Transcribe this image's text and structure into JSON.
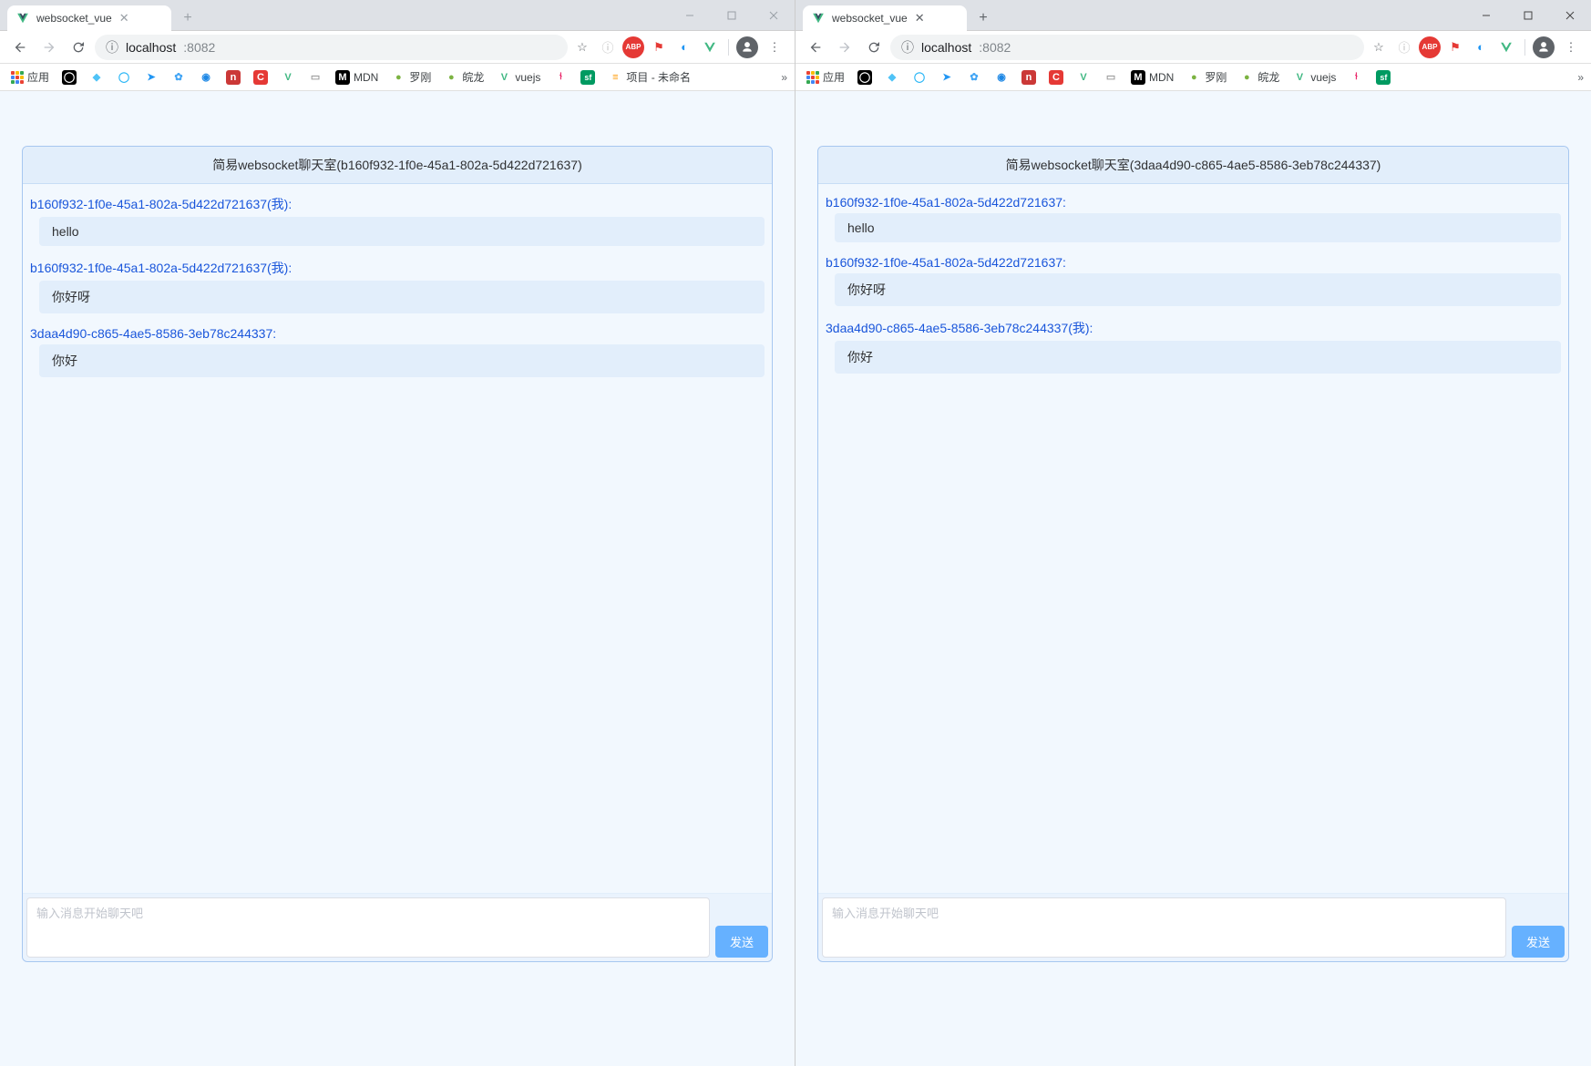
{
  "windows": [
    {
      "active": false,
      "tab_title": "websocket_vue",
      "url_host": "localhost",
      "url_port": ":8082",
      "card_title": "简易websocket聊天室(b160f932-1f0e-45a1-802a-5d422d721637)",
      "messages": [
        {
          "sender": "b160f932-1f0e-45a1-802a-5d422d721637(我):",
          "text": "hello"
        },
        {
          "sender": "b160f932-1f0e-45a1-802a-5d422d721637(我):",
          "text": "你好呀"
        },
        {
          "sender": "3daa4d90-c865-4ae5-8586-3eb78c244337:",
          "text": "你好"
        }
      ],
      "placeholder": "输入消息开始聊天吧",
      "send_label": "发送"
    },
    {
      "active": true,
      "tab_title": "websocket_vue",
      "url_host": "localhost",
      "url_port": ":8082",
      "card_title": "简易websocket聊天室(3daa4d90-c865-4ae5-8586-3eb78c244337)",
      "messages": [
        {
          "sender": "b160f932-1f0e-45a1-802a-5d422d721637:",
          "text": "hello"
        },
        {
          "sender": "b160f932-1f0e-45a1-802a-5d422d721637:",
          "text": "你好呀"
        },
        {
          "sender": "3daa4d90-c865-4ae5-8586-3eb78c244337(我):",
          "text": "你好"
        }
      ],
      "placeholder": "输入消息开始聊天吧",
      "send_label": "发送"
    }
  ],
  "bookmarks": {
    "apps_label": "应用",
    "items": [
      {
        "name": "github",
        "bg": "#000",
        "glyph": "G"
      },
      {
        "name": "diamond",
        "bg": "#4fc3f7",
        "glyph": "◆"
      },
      {
        "name": "circle-o",
        "bg": "#29b6f6",
        "glyph": "◯"
      },
      {
        "name": "send",
        "bg": "#2196f3",
        "glyph": "➤"
      },
      {
        "name": "paw",
        "bg": "#42a5f5",
        "glyph": "✿"
      },
      {
        "name": "target",
        "bg": "#1e88e5",
        "glyph": "◉"
      },
      {
        "name": "npm",
        "bg": "#cb3837",
        "glyph": "n"
      },
      {
        "name": "coda",
        "bg": "#e53935",
        "glyph": "C"
      },
      {
        "name": "vue",
        "bg": "#fff",
        "glyph": "V"
      },
      {
        "name": "page",
        "bg": "#ccc",
        "glyph": "▭"
      },
      {
        "name": "mdn",
        "bg": "#000",
        "glyph": "M",
        "label": "MDN"
      },
      {
        "name": "luogang",
        "bg": "#7cb342",
        "glyph": "●",
        "label": "罗刚"
      },
      {
        "name": "wanlong",
        "bg": "#7cb342",
        "glyph": "●",
        "label": "皖龙"
      },
      {
        "name": "vuejs",
        "bg": "#fff",
        "glyph": "V",
        "label": "vuejs"
      },
      {
        "name": "chart",
        "bg": "#fff",
        "glyph": "⫮"
      },
      {
        "name": "sf",
        "bg": "#009a61",
        "glyph": "sf"
      },
      {
        "name": "proj",
        "bg": "#ff9800",
        "glyph": "≡",
        "label": "项目 - 未命名"
      }
    ]
  },
  "ext_icons": [
    {
      "name": "star-icon",
      "color": "#5f6368",
      "glyph": "☆"
    },
    {
      "name": "info-icon",
      "color": "#bdbdbd",
      "glyph": "ⓘ"
    },
    {
      "name": "abp-icon",
      "color": "#e53935",
      "glyph": "ABP"
    },
    {
      "name": "flag-icon",
      "color": "#e53935",
      "glyph": "⚑"
    },
    {
      "name": "globe-icon",
      "color": "#2196f3",
      "glyph": "◐"
    },
    {
      "name": "vue-ext-icon",
      "color": "#41b883",
      "glyph": "V"
    }
  ]
}
